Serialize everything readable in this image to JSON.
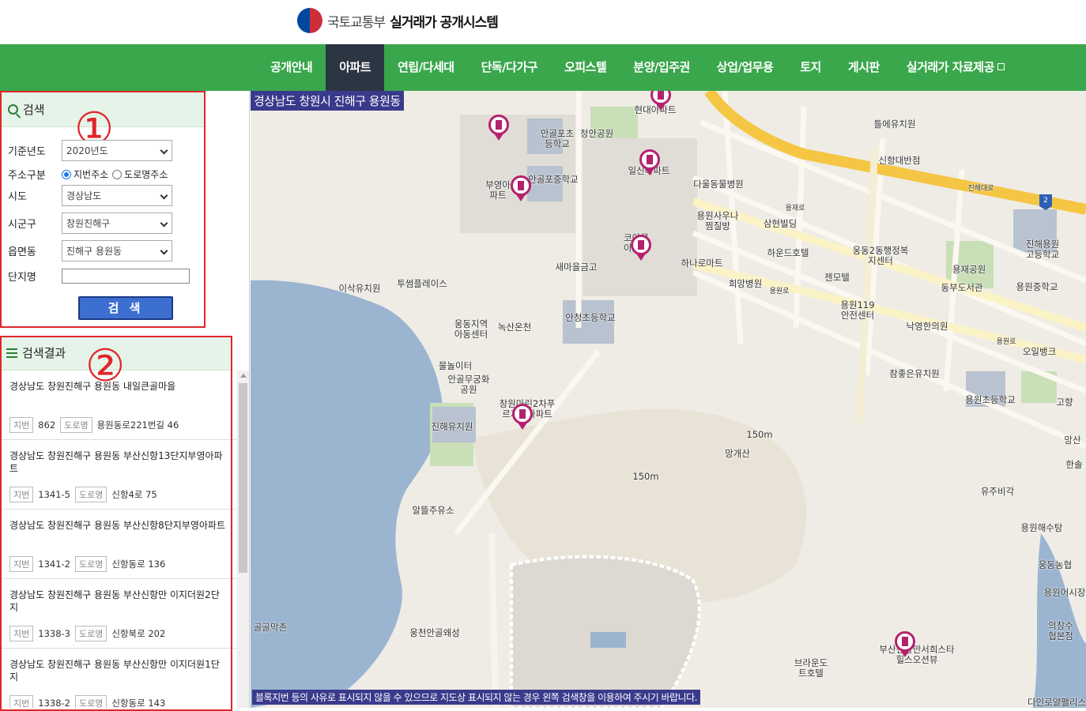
{
  "header": {
    "ministry": "국토교통부",
    "system_title": "실거래가 공개시스템"
  },
  "nav": {
    "items": [
      {
        "label": "공개안내"
      },
      {
        "label": "아파트",
        "active": true
      },
      {
        "label": "연립/다세대"
      },
      {
        "label": "단독/다가구"
      },
      {
        "label": "오피스텔"
      },
      {
        "label": "분양/입주권"
      },
      {
        "label": "상업/업무용"
      },
      {
        "label": "토지"
      },
      {
        "label": "게시판"
      },
      {
        "label": "실거래가 자료제공",
        "icon": "external-link-icon"
      }
    ]
  },
  "search": {
    "title": "검색",
    "marker": "①",
    "year_label": "기준년도",
    "year_value": "2020년도",
    "addr_type_label": "주소구분",
    "addr_type_options": [
      "지번주소",
      "도로명주소"
    ],
    "addr_type_selected": "지번주소",
    "sido_label": "시도",
    "sido_value": "경상남도",
    "sigungu_label": "시군구",
    "sigungu_value": "창원진해구",
    "dong_label": "읍면동",
    "dong_value": "진해구 용원동",
    "complex_label": "단지명",
    "complex_value": "",
    "button_label": "검 색"
  },
  "results": {
    "title": "검색결과",
    "marker": "②",
    "jibun_tag": "지번",
    "road_tag": "도로명",
    "items": [
      {
        "address": "경상남도 창원진해구 용원동 내일큰골마을",
        "jibun": "862",
        "road": "용원동로221번길 46"
      },
      {
        "address": "경상남도 창원진해구 용원동 부산신항13단지부영아파트",
        "jibun": "1341-5",
        "road": "신항4로 75"
      },
      {
        "address": "경상남도 창원진해구 용원동 부산신항8단지부영아파트",
        "jibun": "1341-2",
        "road": "신항동로 136"
      },
      {
        "address": "경상남도 창원진해구 용원동 부산신항만 이지더원2단지",
        "jibun": "1338-3",
        "road": "신항북로 202"
      },
      {
        "address": "경상남도 창원진해구 용원동 부산신항만 이지더원1단지",
        "jibun": "1338-2",
        "road": "신항동로 143"
      }
    ]
  },
  "map": {
    "region_label": "경상남도 창원시 진해구 용원동",
    "notice": "블록지번 등의 사유로 표시되지 않을 수 있으므로 지도상 표시되지 않는 경우 왼쪽 검색창을 이용하여 주시기 바랍니다.",
    "colors": {
      "road_major": "#f5c643",
      "road_minor": "#fbf3c6",
      "water": "#9bb5d1",
      "green": "#c9dfb8",
      "pin": "#b5206e"
    },
    "labels": [
      "현대아파트",
      "틀에유치원",
      "신항대반점",
      "안골포초등학교",
      "청안공원",
      "일신아파트",
      "부영아파트",
      "안골포중학교",
      "다울동물병원",
      "용원사우나찜질방",
      "삼현빌딩",
      "진해용원고등학교",
      "코아루아파트",
      "하운드호텔",
      "웅동2동행정복지센터",
      "용재공원",
      "새마을금고",
      "하나로마트",
      "희망병원",
      "젠모텔",
      "동부도서관",
      "용원중학교",
      "이삭유치원",
      "투썸플레이스",
      "용원119안전센터",
      "낙영한의원",
      "안청초등학교",
      "웅동지역아동센터",
      "녹산온천",
      "오일뱅크",
      "물놀이터",
      "안골무궁화공원",
      "참좋은유치원",
      "용원초등학교",
      "고향",
      "진해유치원",
      "창원마린2차푸르지오아파트",
      "망개산",
      "150m",
      "150m",
      "알뜰주유소",
      "유주비각",
      "용원해수탕",
      "웅동농협",
      "골골막촌",
      "웅천안골왜성",
      "부산신항만서희스타힐스오션뷰",
      "브라운도트호텔",
      "의창수협본점",
      "다인로얄팰리스",
      "망산",
      "한솔",
      "용원어시장",
      "용재로",
      "용원로",
      "진해대로",
      "용원로",
      "2"
    ]
  }
}
